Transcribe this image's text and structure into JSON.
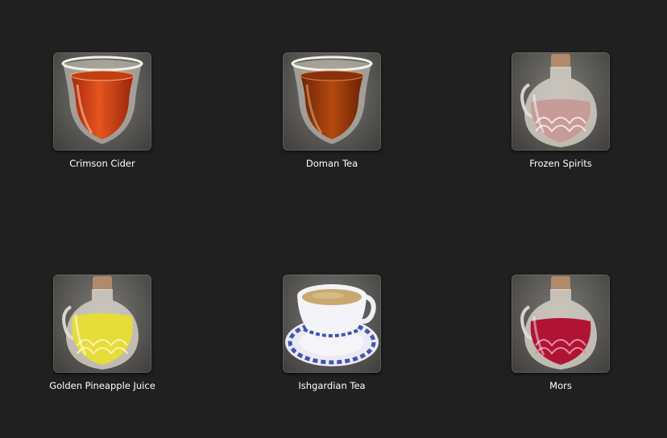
{
  "items": [
    {
      "label": "Crimson Cider",
      "icon": "cider-cup-icon"
    },
    {
      "label": "Doman Tea",
      "icon": "tea-glass-icon"
    },
    {
      "label": "Frozen Spirits",
      "icon": "spirits-carafe-icon"
    },
    {
      "label": "Golden Pineapple Juice",
      "icon": "juice-carafe-icon"
    },
    {
      "label": "Ishgardian Tea",
      "icon": "teacup-saucer-icon"
    },
    {
      "label": "Mors",
      "icon": "mors-carafe-icon"
    }
  ],
  "colors": {
    "background": "#202020",
    "label": "#ffffff",
    "cider": "#d2461a",
    "doman_tea": "#9a3a0a",
    "frozen_spirits": "#c79b98",
    "pineapple_juice": "#e6dc3a",
    "ishgardian_tea": "#c9a870",
    "mors": "#b01434"
  }
}
